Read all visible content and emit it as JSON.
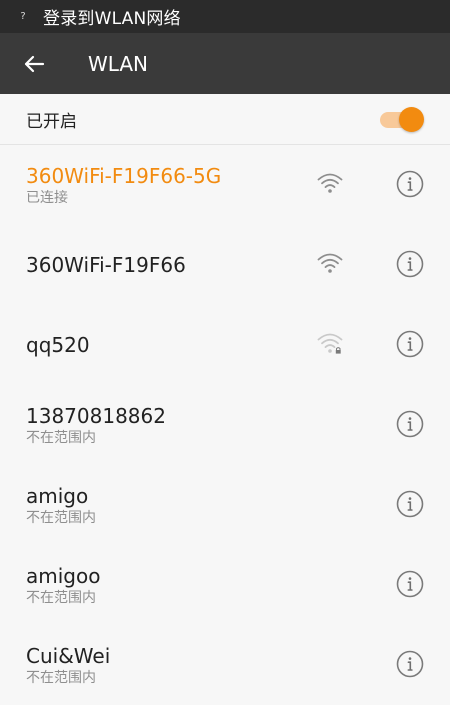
{
  "status_bar": {
    "icon": "question-icon",
    "text": "登录到WLAN网络"
  },
  "app_bar": {
    "title": "WLAN",
    "back_icon": "arrow-left-icon"
  },
  "wlan_toggle": {
    "label": "已开启",
    "state": "on",
    "accent": "#f28b10"
  },
  "networks": [
    {
      "name": "360WiFi-F19F66-5G",
      "status": "已连接",
      "connected": true,
      "signal": "strong",
      "locked": false
    },
    {
      "name": "360WiFi-F19F66",
      "status": "",
      "connected": false,
      "signal": "strong",
      "locked": false
    },
    {
      "name": "qq520",
      "status": "",
      "connected": false,
      "signal": "weak",
      "locked": true
    },
    {
      "name": "13870818862",
      "status": "不在范围内",
      "connected": false,
      "signal": "none",
      "locked": false
    },
    {
      "name": "amigo",
      "status": "不在范围内",
      "connected": false,
      "signal": "none",
      "locked": false
    },
    {
      "name": "amigoo",
      "status": "不在范围内",
      "connected": false,
      "signal": "none",
      "locked": false
    },
    {
      "name": "Cui&Wei",
      "status": "不在范围内",
      "connected": false,
      "signal": "none",
      "locked": false
    }
  ],
  "colors": {
    "accent": "#f28b10",
    "app_bar": "#3a3a3a",
    "status_bar": "#2b2b2b",
    "background": "#f7f7f7"
  }
}
